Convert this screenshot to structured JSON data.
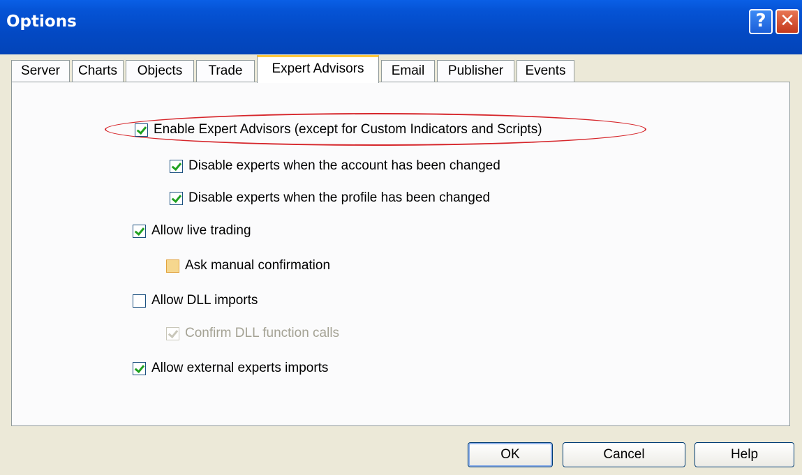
{
  "window": {
    "title": "Options",
    "help_glyph": "?",
    "close_glyph": "✕"
  },
  "tabs": [
    {
      "label": "Server"
    },
    {
      "label": "Charts"
    },
    {
      "label": "Objects"
    },
    {
      "label": "Trade"
    },
    {
      "label": "Expert Advisors"
    },
    {
      "label": "Email"
    },
    {
      "label": "Publisher"
    },
    {
      "label": "Events"
    }
  ],
  "active_tab": "Expert Advisors",
  "options": [
    {
      "label": "Enable Expert Advisors (except for Custom Indicators and Scripts)",
      "checked": true,
      "highlighted": true
    },
    {
      "label": "Disable experts when the account has been changed",
      "checked": true
    },
    {
      "label": "Disable experts when the profile has been changed",
      "checked": true
    },
    {
      "label": "Allow live trading",
      "checked": true
    },
    {
      "label": "Ask manual confirmation",
      "checked": false,
      "hover": true
    },
    {
      "label": "Allow DLL imports",
      "checked": false
    },
    {
      "label": "Confirm DLL function calls",
      "checked": true,
      "disabled": true
    },
    {
      "label": "Allow external experts imports",
      "checked": true
    }
  ],
  "buttons": {
    "ok": "OK",
    "cancel": "Cancel",
    "help": "Help"
  },
  "colors": {
    "titlebar": "#0553d5",
    "annotation": "#d6262b",
    "check": "#21a121"
  }
}
